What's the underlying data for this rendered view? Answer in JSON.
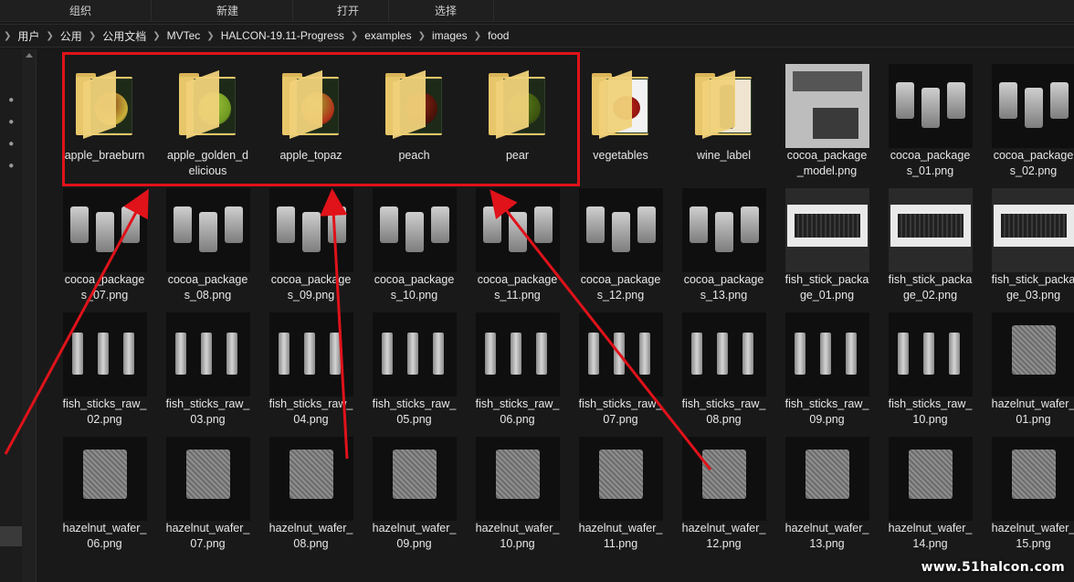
{
  "command_bar": {
    "items": [
      "组织",
      "新建",
      "打开",
      "选择"
    ]
  },
  "address_bar": {
    "crumbs": [
      "用户",
      "公用",
      "公用文档",
      "MVTec",
      "HALCON-19.11-Progress",
      "examples",
      "images",
      "food"
    ]
  },
  "rows": [
    [
      {
        "kind": "folder",
        "name": "apple_braeburn",
        "lines": [
          "apple_braeburn"
        ]
      },
      {
        "kind": "folder",
        "name": "apple_golden_delicious",
        "lines": [
          "apple_golden_d",
          "elicious"
        ]
      },
      {
        "kind": "folder",
        "name": "apple_topaz",
        "lines": [
          "apple_topaz"
        ]
      },
      {
        "kind": "folder",
        "name": "peach",
        "lines": [
          "peach"
        ]
      },
      {
        "kind": "folder",
        "name": "pear",
        "lines": [
          "pear"
        ]
      },
      {
        "kind": "folder",
        "name": "vegetables",
        "lines": [
          "vegetables"
        ]
      },
      {
        "kind": "folder",
        "name": "wine_label",
        "lines": [
          "wine_label"
        ]
      },
      {
        "kind": "file",
        "name": "cocoa_package_model.png",
        "lines": [
          "cocoa_package",
          "_model.png"
        ]
      },
      {
        "kind": "file",
        "name": "cocoa_packages_01.png",
        "lines": [
          "cocoa_package",
          "s_01.png"
        ]
      },
      {
        "kind": "file",
        "name": "cocoa_packages_02.png",
        "lines": [
          "cocoa_package",
          "s_02.png"
        ]
      }
    ],
    [
      {
        "kind": "file",
        "name": "cocoa_packages_07.png",
        "lines": [
          "cocoa_package",
          "s_07.png"
        ]
      },
      {
        "kind": "file",
        "name": "cocoa_packages_08.png",
        "lines": [
          "cocoa_package",
          "s_08.png"
        ]
      },
      {
        "kind": "file",
        "name": "cocoa_packages_09.png",
        "lines": [
          "cocoa_package",
          "s_09.png"
        ]
      },
      {
        "kind": "file",
        "name": "cocoa_packages_10.png",
        "lines": [
          "cocoa_package",
          "s_10.png"
        ]
      },
      {
        "kind": "file",
        "name": "cocoa_packages_11.png",
        "lines": [
          "cocoa_package",
          "s_11.png"
        ]
      },
      {
        "kind": "file",
        "name": "cocoa_packages_12.png",
        "lines": [
          "cocoa_package",
          "s_12.png"
        ]
      },
      {
        "kind": "file",
        "name": "cocoa_packages_13.png",
        "lines": [
          "cocoa_package",
          "s_13.png"
        ]
      },
      {
        "kind": "file",
        "name": "fish_stick_package_01.png",
        "lines": [
          "fish_stick_packa",
          "ge_01.png"
        ]
      },
      {
        "kind": "file",
        "name": "fish_stick_package_02.png",
        "lines": [
          "fish_stick_packa",
          "ge_02.png"
        ]
      },
      {
        "kind": "file",
        "name": "fish_stick_package_03.png",
        "lines": [
          "fish_stick_packa",
          "ge_03.png"
        ]
      }
    ],
    [
      {
        "kind": "file",
        "name": "fish_sticks_raw_02.png",
        "lines": [
          "fish_sticks_raw_",
          "02.png"
        ]
      },
      {
        "kind": "file",
        "name": "fish_sticks_raw_03.png",
        "lines": [
          "fish_sticks_raw_",
          "03.png"
        ]
      },
      {
        "kind": "file",
        "name": "fish_sticks_raw_04.png",
        "lines": [
          "fish_sticks_raw_",
          "04.png"
        ]
      },
      {
        "kind": "file",
        "name": "fish_sticks_raw_05.png",
        "lines": [
          "fish_sticks_raw_",
          "05.png"
        ]
      },
      {
        "kind": "file",
        "name": "fish_sticks_raw_06.png",
        "lines": [
          "fish_sticks_raw_",
          "06.png"
        ]
      },
      {
        "kind": "file",
        "name": "fish_sticks_raw_07.png",
        "lines": [
          "fish_sticks_raw_",
          "07.png"
        ]
      },
      {
        "kind": "file",
        "name": "fish_sticks_raw_08.png",
        "lines": [
          "fish_sticks_raw_",
          "08.png"
        ]
      },
      {
        "kind": "file",
        "name": "fish_sticks_raw_09.png",
        "lines": [
          "fish_sticks_raw_",
          "09.png"
        ]
      },
      {
        "kind": "file",
        "name": "fish_sticks_raw_10.png",
        "lines": [
          "fish_sticks_raw_",
          "10.png"
        ]
      },
      {
        "kind": "file",
        "name": "hazelnut_wafer_01.png",
        "lines": [
          "hazelnut_wafer_",
          "01.png"
        ]
      }
    ],
    [
      {
        "kind": "file",
        "name": "hazelnut_wafer_06.png",
        "lines": [
          "hazelnut_wafer_",
          "06.png"
        ]
      },
      {
        "kind": "file",
        "name": "hazelnut_wafer_07.png",
        "lines": [
          "hazelnut_wafer_",
          "07.png"
        ]
      },
      {
        "kind": "file",
        "name": "hazelnut_wafer_08.png",
        "lines": [
          "hazelnut_wafer_",
          "08.png"
        ]
      },
      {
        "kind": "file",
        "name": "hazelnut_wafer_09.png",
        "lines": [
          "hazelnut_wafer_",
          "09.png"
        ]
      },
      {
        "kind": "file",
        "name": "hazelnut_wafer_10.png",
        "lines": [
          "hazelnut_wafer_",
          "10.png"
        ]
      },
      {
        "kind": "file",
        "name": "hazelnut_wafer_11.png",
        "lines": [
          "hazelnut_wafer_",
          "11.png"
        ]
      },
      {
        "kind": "file",
        "name": "hazelnut_wafer_12.png",
        "lines": [
          "hazelnut_wafer_",
          "12.png"
        ]
      },
      {
        "kind": "file",
        "name": "hazelnut_wafer_13.png",
        "lines": [
          "hazelnut_wafer_",
          "13.png"
        ]
      },
      {
        "kind": "file",
        "name": "hazelnut_wafer_14.png",
        "lines": [
          "hazelnut_wafer_",
          "14.png"
        ]
      },
      {
        "kind": "file",
        "name": "hazelnut_wafer_15.png",
        "lines": [
          "hazelnut_wafer_",
          "15.png"
        ]
      }
    ]
  ],
  "annotation": {
    "highlight_color": "#e0121a",
    "watermark": "www.51halcon.com"
  },
  "colors": {
    "background": "#191919",
    "folder": "#e8c66a",
    "text": "#e8e8e8"
  },
  "icons": {
    "chevron": "chevron-right-icon",
    "pin": "pin-icon",
    "folder": "folder-icon"
  }
}
